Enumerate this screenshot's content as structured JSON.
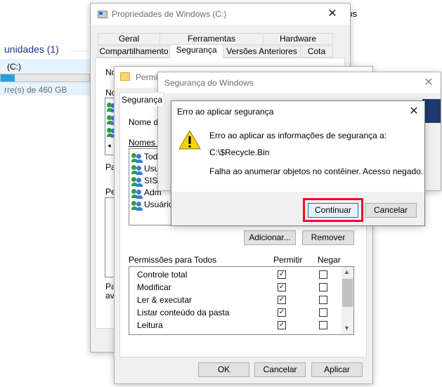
{
  "explorer": {
    "header_fragment": "eos",
    "section_title": "unidades (1)",
    "drive_label": "(C:)",
    "drive_free": "rre(s) de 460 GB",
    "usage_fill": 0.16
  },
  "props_window": {
    "title": "Propriedades de Windows (C:)",
    "tabs_row1": [
      "Geral",
      "Ferramentas",
      "Hardware"
    ],
    "tabs_row2": [
      "Compartilhamento",
      "Segurança",
      "Versões Anteriores",
      "Cota"
    ],
    "selected_tab": "Segurança",
    "clipped_labels": [
      "No",
      "No",
      "Pa",
      "Pe",
      "Pa",
      "ava"
    ]
  },
  "perm_window": {
    "title": "Permis",
    "tab": "Segurança",
    "object_name_label": "Nome do",
    "group_names_label": "Nomes de",
    "users": [
      "Todo",
      "Usu",
      "SIST",
      "Adm",
      "Usuário"
    ],
    "add_button": "Adicionar...",
    "remove_button": "Remover",
    "permissions_for": "Permissões para Todos",
    "allow_col": "Permitir",
    "deny_col": "Negar",
    "permissions": [
      {
        "name": "Controle total",
        "allow": true,
        "deny": false
      },
      {
        "name": "Modificar",
        "allow": true,
        "deny": false
      },
      {
        "name": "Ler & executar",
        "allow": true,
        "deny": false
      },
      {
        "name": "Listar conteúdo da pasta",
        "allow": true,
        "deny": false
      },
      {
        "name": "Leitura",
        "allow": true,
        "deny": false
      }
    ],
    "ok_button": "OK",
    "cancel_button": "Cancelar",
    "apply_button": "Aplicar"
  },
  "security_window": {
    "title": "Segurança do Windows"
  },
  "error_dialog": {
    "title": "Erro ao aplicar segurança",
    "message": "Erro ao aplicar as informações de segurança a:",
    "path": "C:\\$Recycle.Bin",
    "detail": "Falha ao anumerar objetos no contêiner. Acesso negado.",
    "continue_button": "Continuar",
    "cancel_button": "Cancelar"
  },
  "colors": {
    "accent_blue": "#0078d7",
    "highlight_red": "#e81123",
    "warning_yellow": "#f7d400",
    "usage_bar": "#26a0da"
  }
}
